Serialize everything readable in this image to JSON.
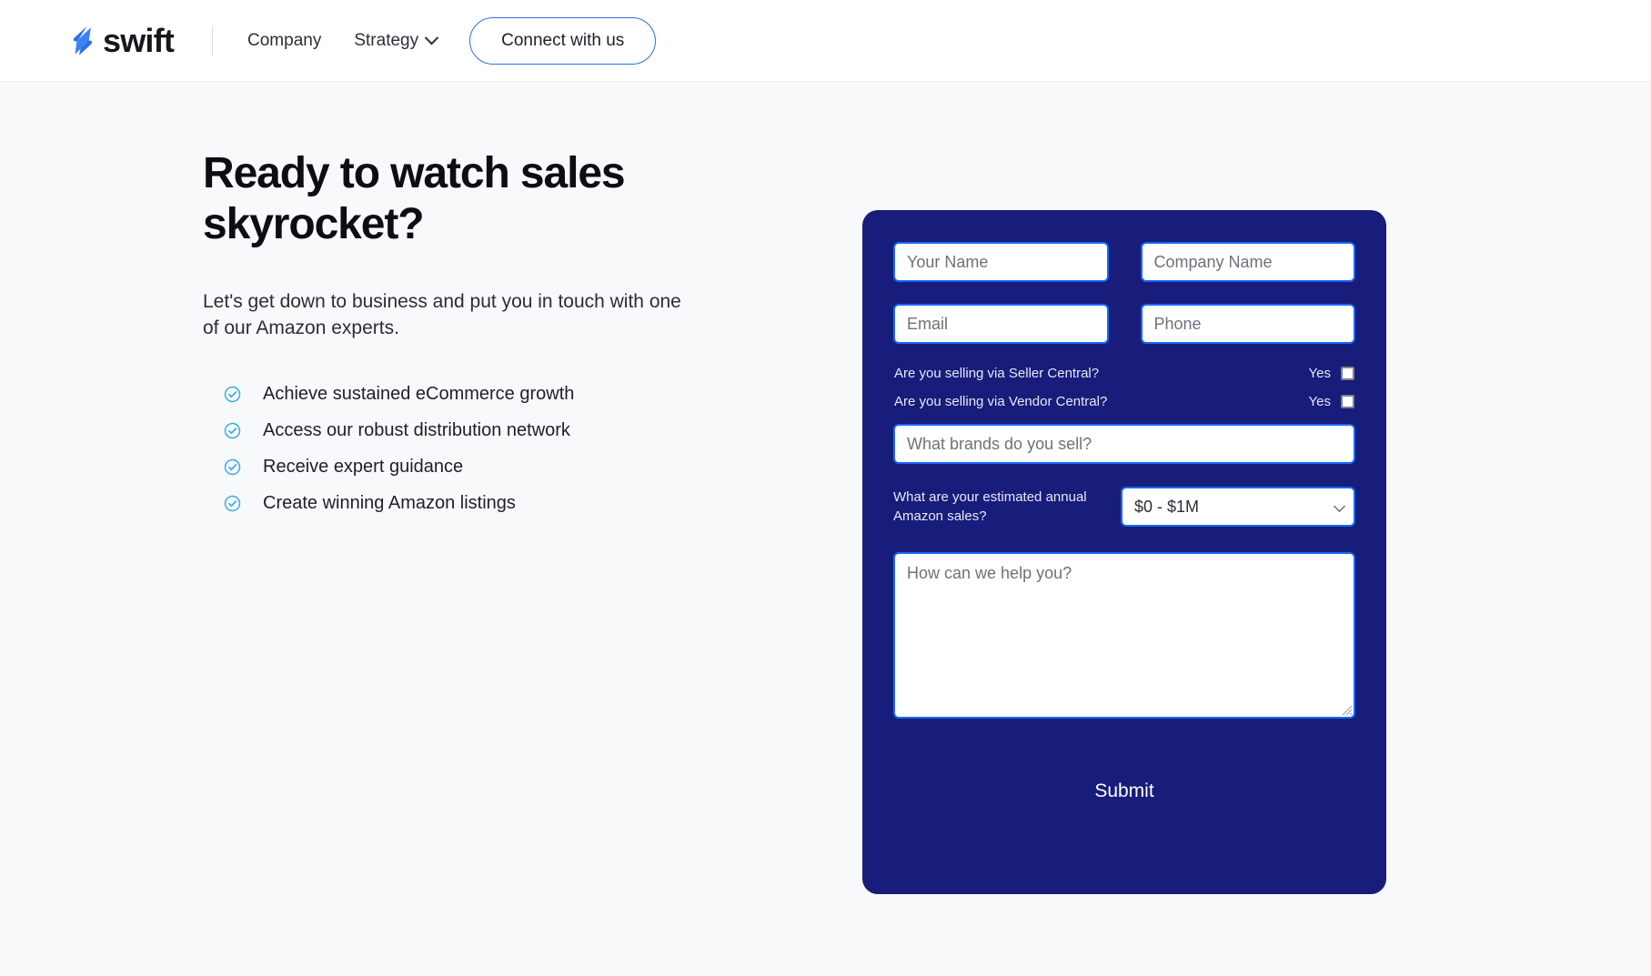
{
  "header": {
    "brand_name": "swift",
    "brand_icon": "swift-logo-icon",
    "nav": [
      {
        "label": "Company",
        "has_chevron": false
      },
      {
        "label": "Strategy",
        "has_chevron": true
      }
    ],
    "cta_label": "Connect with us"
  },
  "hero": {
    "headline": "Ready to watch sales skyrocket?",
    "subcopy": "Let's get down to business and put you in touch with one of our Amazon experts.",
    "benefits": [
      "Achieve sustained eCommerce growth",
      "Access our robust distribution network",
      "Receive expert guidance",
      "Create winning Amazon listings"
    ]
  },
  "form": {
    "name_placeholder": "Your Name",
    "company_placeholder": "Company Name",
    "email_placeholder": "Email",
    "phone_placeholder": "Phone",
    "seller_central_question": "Are you selling via Seller Central?",
    "vendor_central_question": "Are you selling via Vendor Central?",
    "yes_label": "Yes",
    "seller_central_checked": false,
    "vendor_central_checked": false,
    "brands_placeholder": "What brands do you sell?",
    "sales_question": "What are your estimated annual Amazon sales?",
    "sales_selected": "$0 - $1M",
    "sales_options": [
      "$0 - $1M"
    ],
    "message_placeholder": "How can we help you?",
    "submit_label": "Submit"
  },
  "colors": {
    "page_background": "#f8f9fb",
    "header_background": "#ffffff",
    "card_background": "#181c7a",
    "input_border": "#1769f5",
    "accent_blue": "#2f6fe4",
    "check_blue": "#34a8ec"
  }
}
